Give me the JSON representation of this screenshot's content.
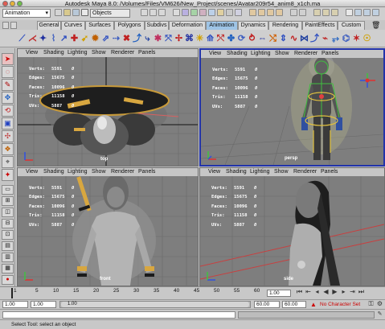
{
  "window": {
    "title": "Autodesk Maya 8.0: /Volumes/Files/VM626/New_Project/scenes/Avatar209r54_anim8_x1ch.ma"
  },
  "status_line": {
    "menu_set": "Animation",
    "selection_mode": "Objects"
  },
  "shelf_tabs": [
    "General",
    "Curves",
    "Surfaces",
    "Polygons",
    "Subdivs",
    "Deformation",
    "Animation",
    "Dynamics",
    "Rendering",
    "PaintEffects",
    "Custom"
  ],
  "active_shelf_tab": "Animation",
  "viewport_menu": [
    "View",
    "Shading",
    "Lighting",
    "Show",
    "Renderer",
    "Panels"
  ],
  "hud": {
    "labels": [
      "Verts:",
      "Edges:",
      "Faces:",
      "Tris:",
      "UVs:"
    ],
    "values": [
      "5591",
      "15675",
      "10096",
      "11158",
      "5887"
    ],
    "zeros": [
      "0",
      "0",
      "0",
      "0",
      "0"
    ]
  },
  "viewports": {
    "top_left": {
      "camera": "top"
    },
    "top_right": {
      "camera": "persp"
    },
    "bottom_left": {
      "camera": "front"
    },
    "bottom_right": {
      "camera": "side"
    }
  },
  "timeline": {
    "ticks": [
      "1",
      "5",
      "10",
      "15",
      "20",
      "25",
      "30",
      "35",
      "40",
      "45",
      "50",
      "55",
      "60"
    ],
    "current_frame": "1.00"
  },
  "range": {
    "start": "1.00",
    "inner_start": "1.00",
    "range_label": "1.00",
    "inner_end": "60.00",
    "end": "60.00",
    "character_set": "No Character Set"
  },
  "help_line": "Select Tool: select an object",
  "colors": {
    "accent_tab": "#9ec4e6",
    "active_view_border": "#2233aa",
    "no_char_set": "#cc0000"
  }
}
